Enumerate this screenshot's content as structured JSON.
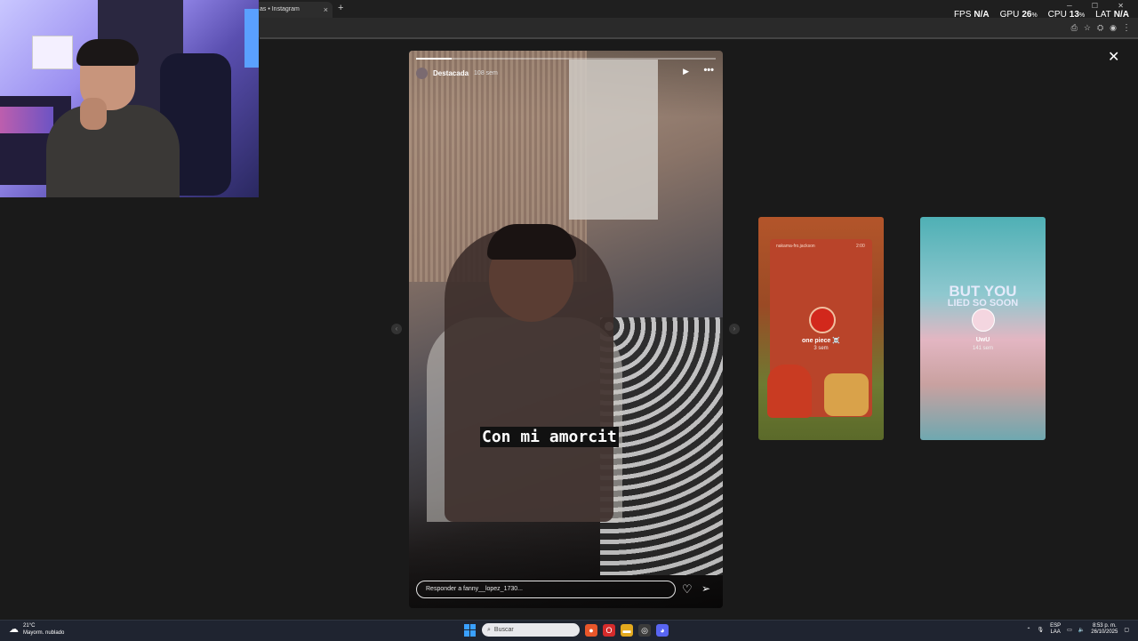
{
  "browser": {
    "tab_title": "as • Instagram",
    "tab_close": "×",
    "new_tab": "+",
    "window_controls": "─ ☐ ✕",
    "toolbar_icons": [
      "⎙",
      "☆",
      "⛭",
      "◉"
    ],
    "menu": "⋮"
  },
  "overlay_stats": [
    {
      "label": "FPS",
      "value": "N/A",
      "unit": ""
    },
    {
      "label": "GPU",
      "value": "26",
      "unit": "%"
    },
    {
      "label": "CPU",
      "value": "13",
      "unit": "%"
    },
    {
      "label": "LAT",
      "value": "N/A",
      "unit": ""
    }
  ],
  "viewer": {
    "close": "✕",
    "prev_arrow": "‹",
    "next_arrow": "›"
  },
  "story": {
    "username": "Destacada",
    "time": "108 sem",
    "progress": 0.12,
    "caption": "Con mi amorcit",
    "reply_placeholder": "Responder a fanny__lopez_1730...",
    "play_icon": "▶",
    "more_icon": "•••",
    "heart_icon": "♡",
    "send_icon": "➢"
  },
  "previews": [
    {
      "name": "one piece ☠️",
      "time": "3 sem",
      "top_left": "nakama-fro.jackson",
      "top_right": "2:00"
    },
    {
      "name": "UwU",
      "time": "141 sem",
      "overlay_line1": "BUT YOU",
      "overlay_line2": "LIED SO SOON"
    }
  ],
  "taskbar": {
    "temp": "21°C",
    "weather": "Mayorm. nublado",
    "search_placeholder": "Buscar",
    "lang1": "ESP",
    "lang2": "LAA",
    "time": "8:53 p. m.",
    "date": "26/10/2025"
  },
  "colors": {
    "accent_blue": "#3aa0ff",
    "page_bg": "#1a1a1a"
  }
}
